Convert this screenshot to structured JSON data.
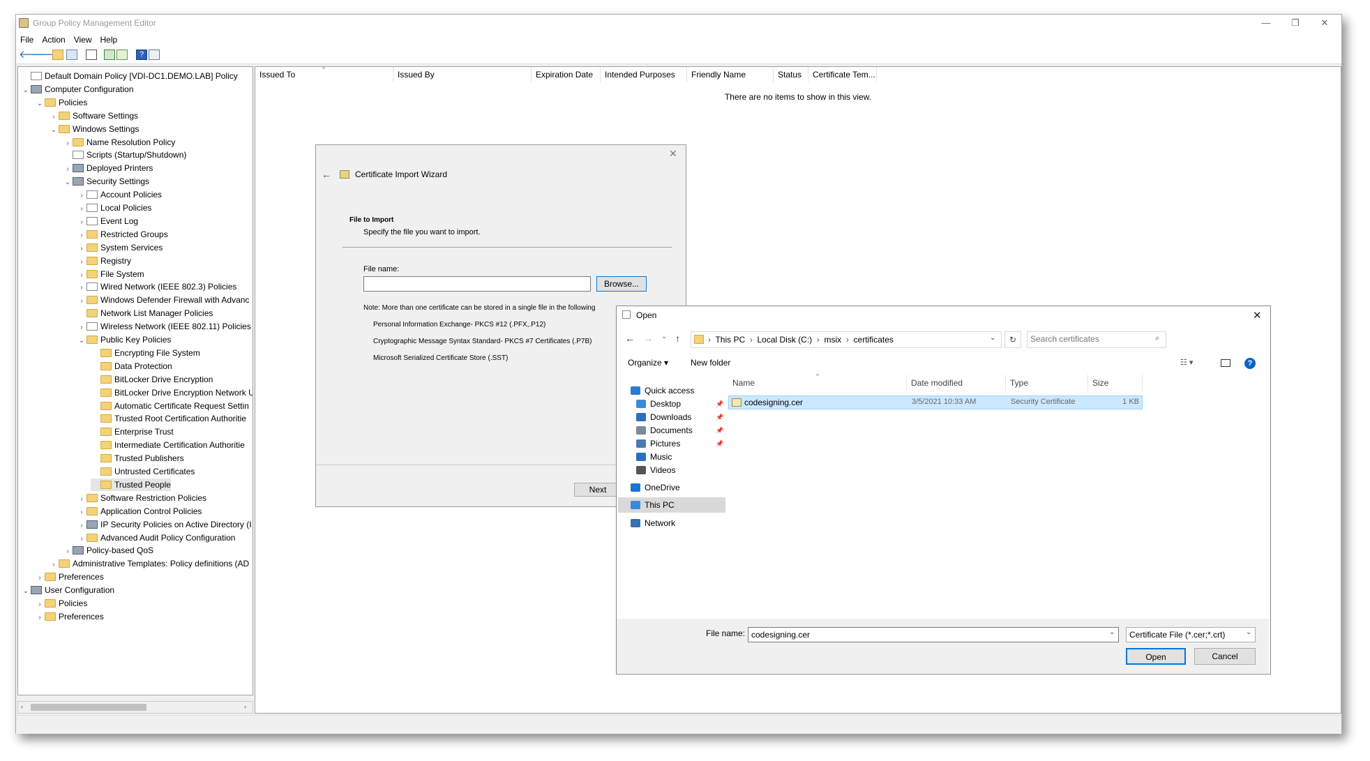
{
  "window": {
    "title": "Group Policy Management Editor",
    "minimize": "—",
    "restore": "❐",
    "close": "✕"
  },
  "menu": [
    "File",
    "Action",
    "View",
    "Help"
  ],
  "tree": [
    {
      "label": "Default Domain Policy [VDI-DC1.DEMO.LAB] Policy",
      "level": 0,
      "chev": "",
      "icon": "doc"
    },
    {
      "label": "Computer Configuration",
      "level": 0,
      "chev": "v",
      "icon": "gear"
    },
    {
      "label": "Policies",
      "level": 1,
      "chev": "v",
      "icon": "folder"
    },
    {
      "label": "Software Settings",
      "level": 2,
      "chev": ">",
      "icon": "folder"
    },
    {
      "label": "Windows Settings",
      "level": 2,
      "chev": "v",
      "icon": "folder"
    },
    {
      "label": "Name Resolution Policy",
      "level": 3,
      "chev": ">",
      "icon": "folder"
    },
    {
      "label": "Scripts (Startup/Shutdown)",
      "level": 3,
      "chev": "",
      "icon": "doc"
    },
    {
      "label": "Deployed Printers",
      "level": 3,
      "chev": ">",
      "icon": "gear"
    },
    {
      "label": "Security Settings",
      "level": 3,
      "chev": "v",
      "icon": "gear"
    },
    {
      "label": "Account Policies",
      "level": 4,
      "chev": ">",
      "icon": "doc"
    },
    {
      "label": "Local Policies",
      "level": 4,
      "chev": ">",
      "icon": "doc"
    },
    {
      "label": "Event Log",
      "level": 4,
      "chev": ">",
      "icon": "doc"
    },
    {
      "label": "Restricted Groups",
      "level": 4,
      "chev": ">",
      "icon": "folder"
    },
    {
      "label": "System Services",
      "level": 4,
      "chev": ">",
      "icon": "folder"
    },
    {
      "label": "Registry",
      "level": 4,
      "chev": ">",
      "icon": "folder"
    },
    {
      "label": "File System",
      "level": 4,
      "chev": ">",
      "icon": "folder"
    },
    {
      "label": "Wired Network (IEEE 802.3) Policies",
      "level": 4,
      "chev": ">",
      "icon": "doc"
    },
    {
      "label": "Windows Defender Firewall with Advanc",
      "level": 4,
      "chev": ">",
      "icon": "folder"
    },
    {
      "label": "Network List Manager Policies",
      "level": 4,
      "chev": "",
      "icon": "folder"
    },
    {
      "label": "Wireless Network (IEEE 802.11) Policies",
      "level": 4,
      "chev": ">",
      "icon": "doc"
    },
    {
      "label": "Public Key Policies",
      "level": 4,
      "chev": "v",
      "icon": "folder"
    },
    {
      "label": "Encrypting File System",
      "level": 5,
      "chev": "",
      "icon": "folder"
    },
    {
      "label": "Data Protection",
      "level": 5,
      "chev": "",
      "icon": "folder"
    },
    {
      "label": "BitLocker Drive Encryption",
      "level": 5,
      "chev": "",
      "icon": "folder"
    },
    {
      "label": "BitLocker Drive Encryption Network U",
      "level": 5,
      "chev": "",
      "icon": "folder"
    },
    {
      "label": "Automatic Certificate Request Settin",
      "level": 5,
      "chev": "",
      "icon": "folder"
    },
    {
      "label": "Trusted Root Certification Authoritie",
      "level": 5,
      "chev": "",
      "icon": "folder"
    },
    {
      "label": "Enterprise Trust",
      "level": 5,
      "chev": "",
      "icon": "folder"
    },
    {
      "label": "Intermediate Certification Authoritie",
      "level": 5,
      "chev": "",
      "icon": "folder"
    },
    {
      "label": "Trusted Publishers",
      "level": 5,
      "chev": "",
      "icon": "folder"
    },
    {
      "label": "Untrusted Certificates",
      "level": 5,
      "chev": "",
      "icon": "folder"
    },
    {
      "label": "Trusted People",
      "level": 5,
      "chev": "",
      "icon": "folder",
      "selected": true
    },
    {
      "label": "Software Restriction Policies",
      "level": 4,
      "chev": ">",
      "icon": "folder"
    },
    {
      "label": "Application Control Policies",
      "level": 4,
      "chev": ">",
      "icon": "folder"
    },
    {
      "label": "IP Security Policies on Active Directory (I",
      "level": 4,
      "chev": ">",
      "icon": "gear"
    },
    {
      "label": "Advanced Audit Policy Configuration",
      "level": 4,
      "chev": ">",
      "icon": "folder"
    },
    {
      "label": "Policy-based QoS",
      "level": 3,
      "chev": ">",
      "icon": "gear"
    },
    {
      "label": "Administrative Templates: Policy definitions (AD",
      "level": 2,
      "chev": ">",
      "icon": "folder"
    },
    {
      "label": "Preferences",
      "level": 1,
      "chev": ">",
      "icon": "folder"
    },
    {
      "label": "User Configuration",
      "level": 0,
      "chev": "v",
      "icon": "gear"
    },
    {
      "label": "Policies",
      "level": 1,
      "chev": ">",
      "icon": "folder"
    },
    {
      "label": "Preferences",
      "level": 1,
      "chev": ">",
      "icon": "folder"
    }
  ],
  "list": {
    "columns": [
      "Issued To",
      "Issued By",
      "Expiration Date",
      "Intended Purposes",
      "Friendly Name",
      "Status",
      "Certificate Tem..."
    ],
    "empty_text": "There are no items to show in this view."
  },
  "wizard": {
    "title": "Certificate Import Wizard",
    "heading": "File to Import",
    "subheading": "Specify the file you want to import.",
    "file_label": "File name:",
    "file_value": "",
    "browse": "Browse...",
    "note": "Note:  More than one certificate can be stored in a single file in the following",
    "formats": [
      "Personal Information Exchange- PKCS #12 (.PFX,.P12)",
      "Cryptographic Message Syntax Standard- PKCS #7 Certificates (.P7B)",
      "Microsoft Serialized Certificate Store (.SST)"
    ],
    "next": "Next"
  },
  "open_dialog": {
    "title": "Open",
    "breadcrumb": [
      "This PC",
      "Local Disk (C:)",
      "msix",
      "certificates"
    ],
    "search_placeholder": "Search certificates",
    "organize": "Organize ▾",
    "new_folder": "New folder",
    "nav": [
      {
        "label": "Quick access",
        "icon": "star-icon",
        "indent": 0,
        "pinned": false
      },
      {
        "label": "Desktop",
        "icon": "desktop-icon",
        "indent": 1,
        "pinned": true
      },
      {
        "label": "Downloads",
        "icon": "download-icon",
        "indent": 1,
        "pinned": true
      },
      {
        "label": "Documents",
        "icon": "documents-icon",
        "indent": 1,
        "pinned": true
      },
      {
        "label": "Pictures",
        "icon": "pictures-icon",
        "indent": 1,
        "pinned": true
      },
      {
        "label": "Music",
        "icon": "music-icon",
        "indent": 1,
        "pinned": false
      },
      {
        "label": "Videos",
        "icon": "videos-icon",
        "indent": 1,
        "pinned": false
      },
      {
        "label": "OneDrive",
        "icon": "cloud-icon",
        "indent": 0,
        "pinned": false
      },
      {
        "label": "This PC",
        "icon": "computer-icon",
        "indent": 0,
        "pinned": false,
        "selected": true
      },
      {
        "label": "Network",
        "icon": "network-icon",
        "indent": 0,
        "pinned": false
      }
    ],
    "columns": [
      "Name",
      "Date modified",
      "Type",
      "Size"
    ],
    "files": [
      {
        "name": "codesigning.cer",
        "date": "3/5/2021 10:33 AM",
        "type": "Security Certificate",
        "size": "1 KB"
      }
    ],
    "filename_label": "File name:",
    "filename_value": "codesigning.cer",
    "filetype": "Certificate File (*.cer;*.crt)",
    "open": "Open",
    "cancel": "Cancel"
  },
  "colors": {
    "accent": "#0078d7",
    "selection": "#cce8ff",
    "folder": "#f4d27a"
  }
}
